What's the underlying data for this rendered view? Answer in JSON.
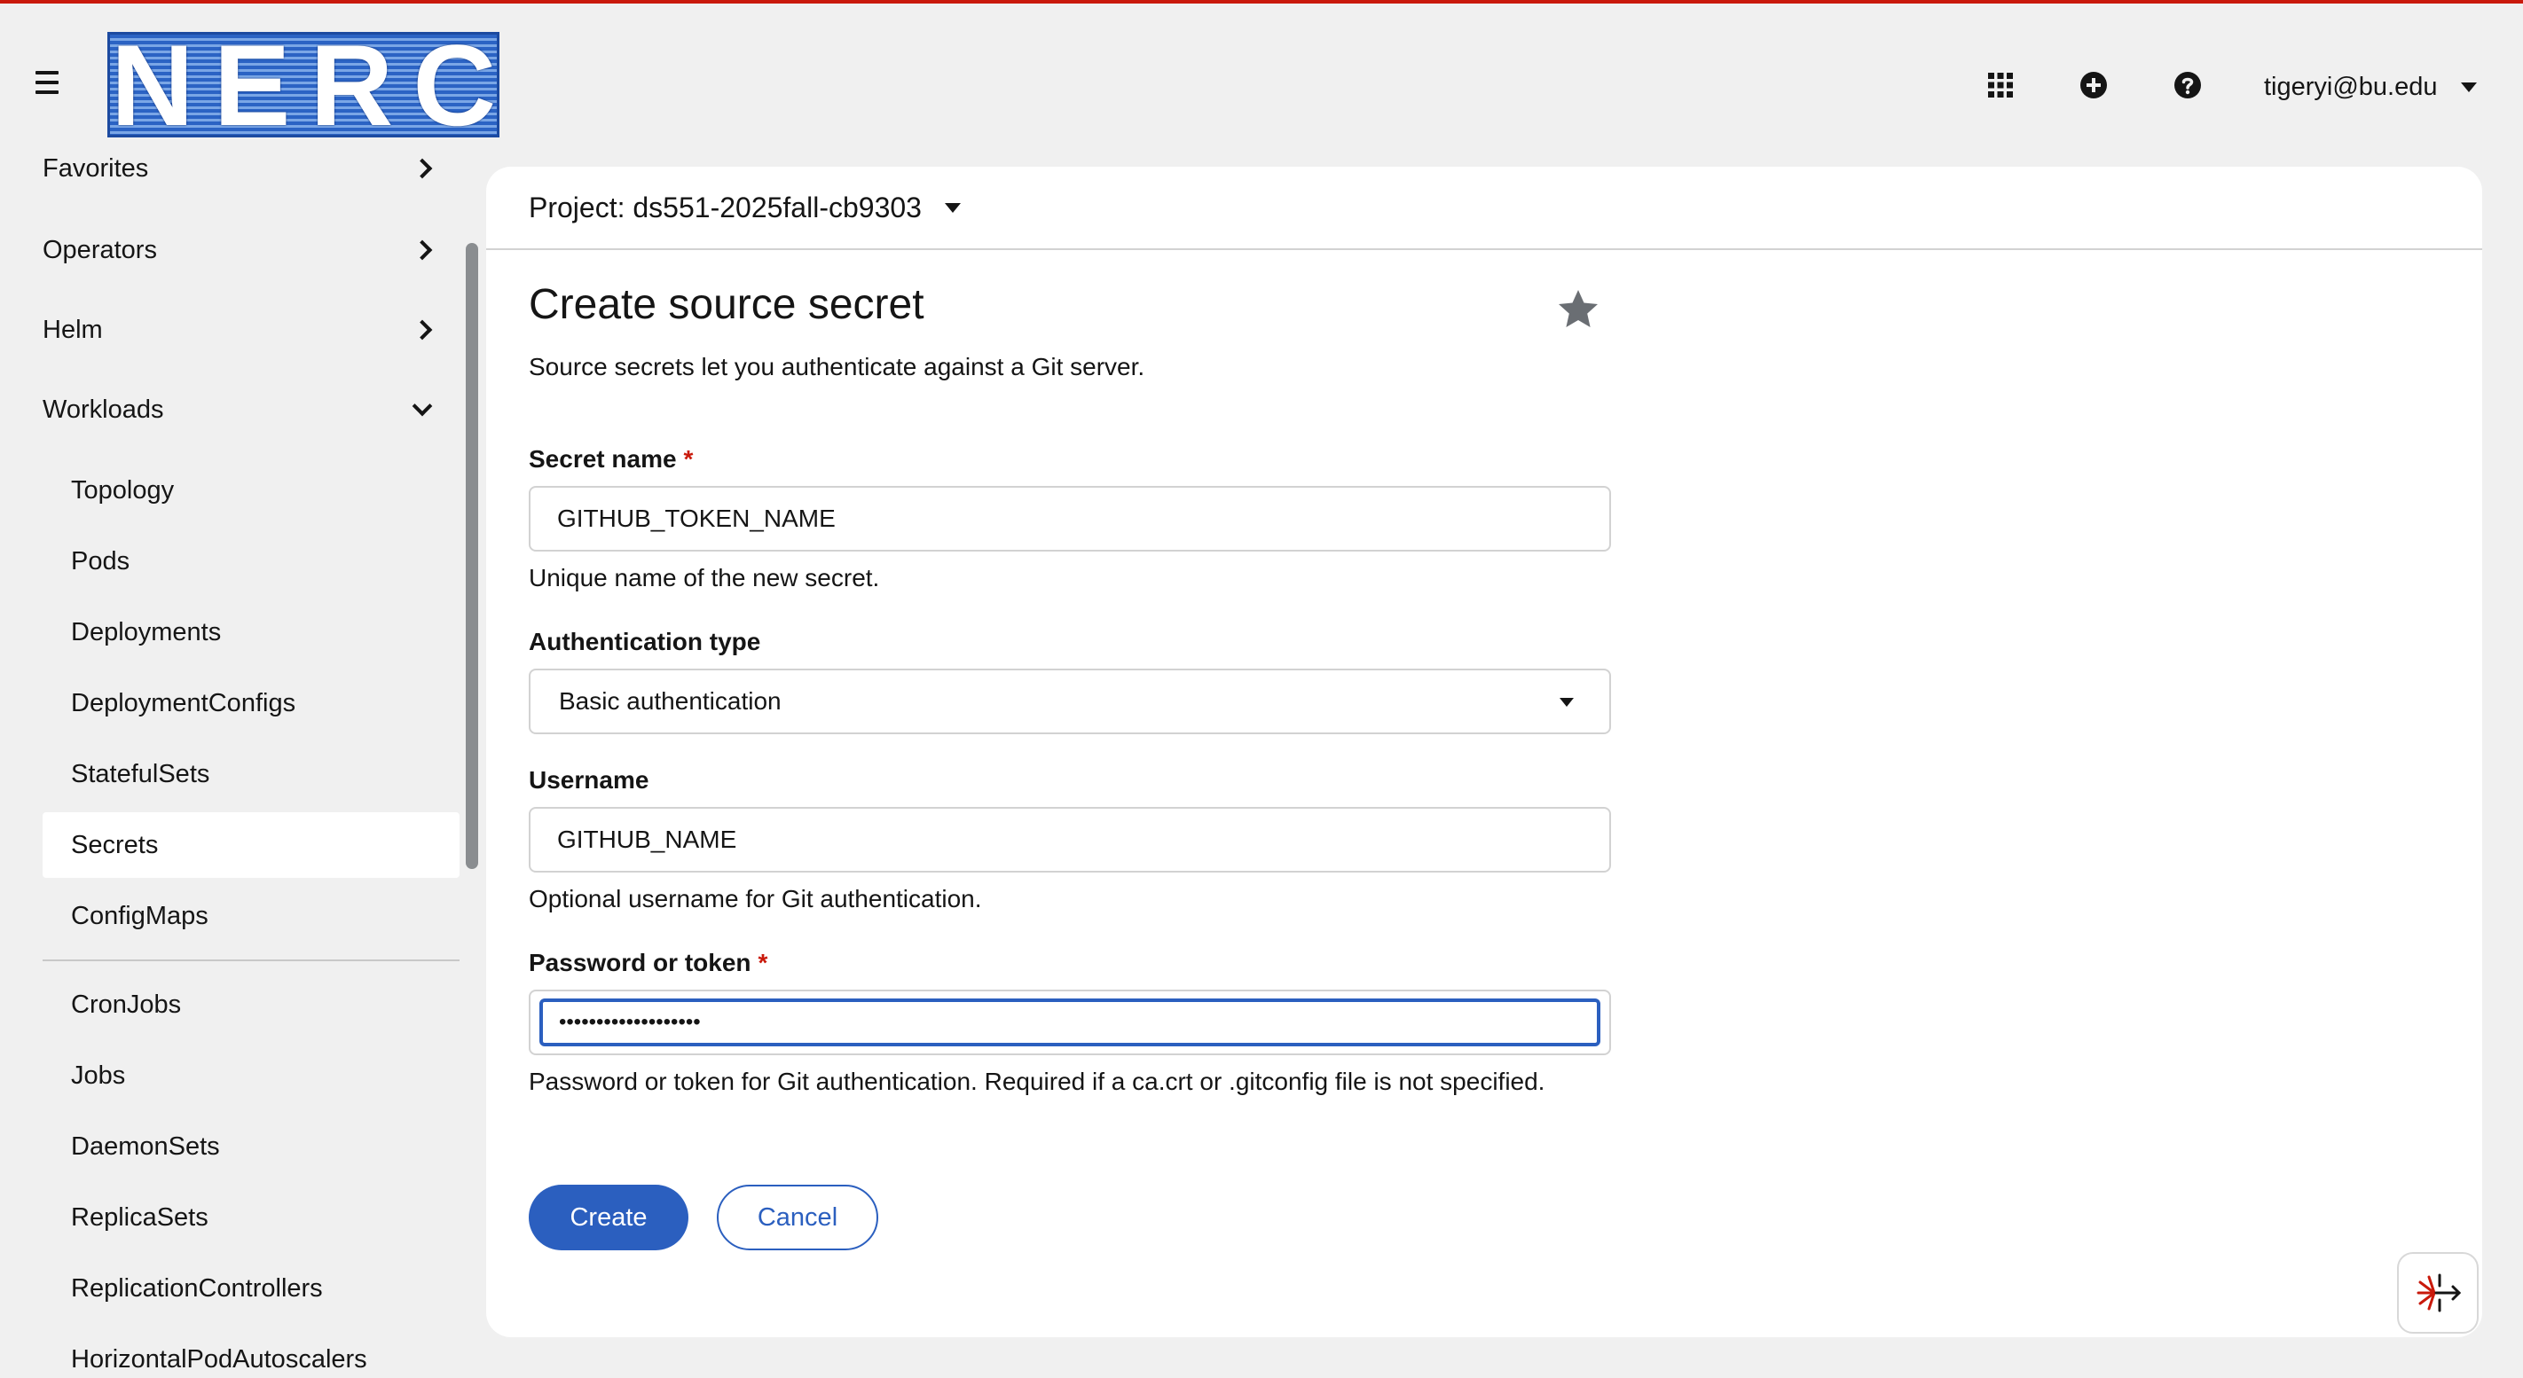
{
  "masthead": {
    "logo_text": "NERC",
    "user_name": "tigeryi@bu.edu",
    "icons": [
      "menu-icon",
      "app-launcher-icon",
      "add-icon",
      "help-icon"
    ]
  },
  "sidebar": {
    "groups": [
      {
        "label": "Favorites"
      },
      {
        "label": "Operators"
      },
      {
        "label": "Helm"
      },
      {
        "label": "Workloads"
      }
    ],
    "items": [
      {
        "label": "Topology"
      },
      {
        "label": "Pods"
      },
      {
        "label": "Deployments"
      },
      {
        "label": "DeploymentConfigs"
      },
      {
        "label": "StatefulSets"
      },
      {
        "label": "Secrets"
      },
      {
        "label": "ConfigMaps"
      },
      {
        "label": "CronJobs"
      },
      {
        "label": "Jobs"
      },
      {
        "label": "DaemonSets"
      },
      {
        "label": "ReplicaSets"
      },
      {
        "label": "ReplicationControllers"
      },
      {
        "label": "HorizontalPodAutoscalers"
      }
    ],
    "active_item": "Secrets"
  },
  "project": {
    "label": "Project: ds551-2025fall-cb9303"
  },
  "form": {
    "title": "Create source secret",
    "description": "Source secrets let you authenticate against a Git server.",
    "secret_name": {
      "label": "Secret name",
      "required_mark": "*",
      "value": "GITHUB_TOKEN_NAME",
      "helper": "Unique name of the new secret."
    },
    "auth_type": {
      "label": "Authentication type",
      "value": "Basic authentication"
    },
    "username": {
      "label": "Username",
      "value": "GITHUB_NAME",
      "helper": "Optional username for Git authentication."
    },
    "password": {
      "label": "Password or token",
      "required_mark": "*",
      "value": "•••••••••••••••••••",
      "helper": "Password or token for Git authentication. Required if a ca.crt or .gitconfig file is not specified."
    },
    "create_label": "Create",
    "cancel_label": "Cancel"
  },
  "colors": {
    "accent": "#2b5fbf",
    "required": "#c9190b",
    "top_line": "#c9190b"
  }
}
